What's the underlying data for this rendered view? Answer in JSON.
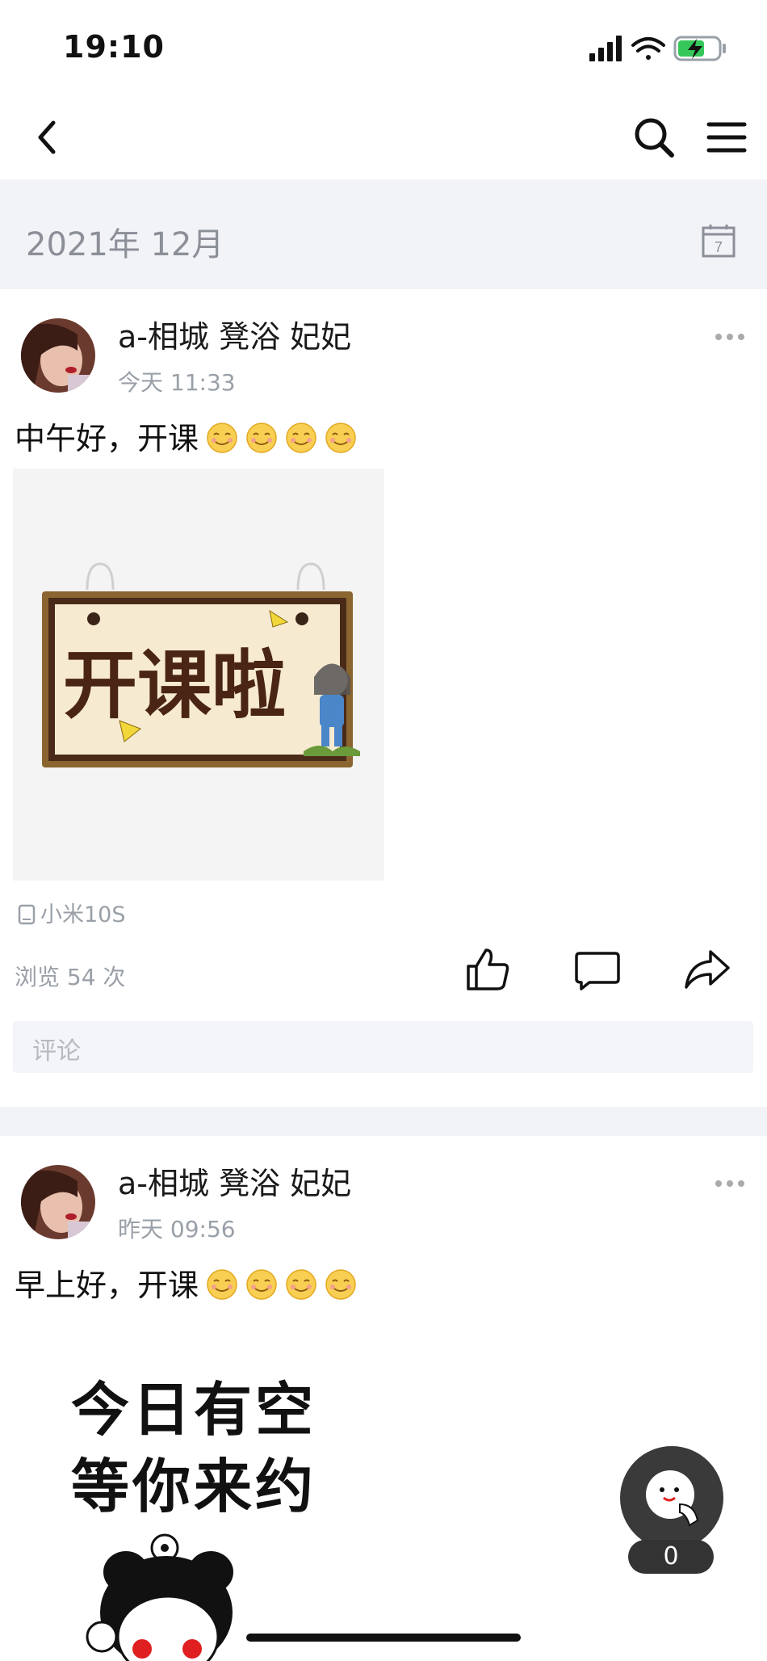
{
  "status_bar": {
    "time": "19:10"
  },
  "nav": {
    "back": "back-icon",
    "search": "search-icon",
    "menu": "menu-icon"
  },
  "date_header": {
    "title": "2021年 12月",
    "calendar_day": "7"
  },
  "posts": [
    {
      "username": "a-相城 凳浴  妃妃",
      "time": "今天 11:33",
      "text": "中午好，开课",
      "emoji_count": 4,
      "image_text": "开课啦",
      "device": "小米10S",
      "views": "浏览 54 次",
      "comment_placeholder": "评论"
    },
    {
      "username": "a-相城 凳浴  妃妃",
      "time": "昨天 09:56",
      "text": "早上好，开课",
      "emoji_count": 4,
      "image_text_line1": "今日有空",
      "image_text_line2": "等你来约"
    }
  ],
  "floating_button": {
    "count": "0"
  },
  "colors": {
    "header_bg": "#f2f3f7",
    "muted_text": "#9aa0a8",
    "accent_green": "#35c759"
  }
}
